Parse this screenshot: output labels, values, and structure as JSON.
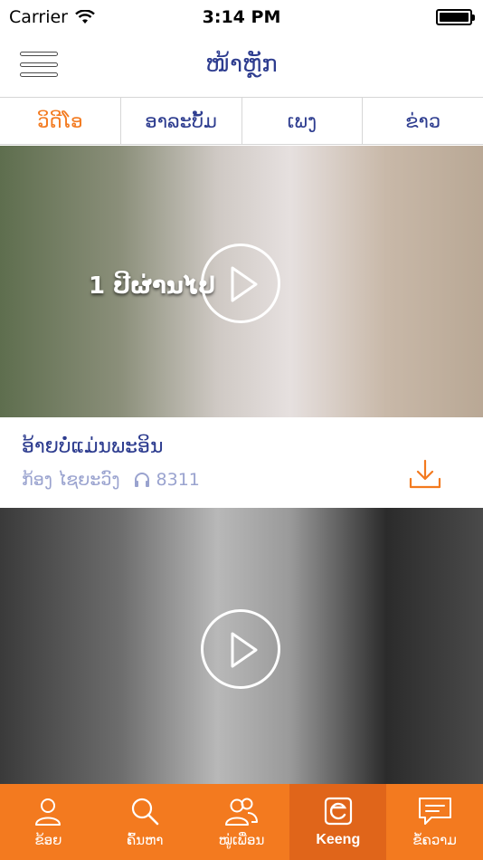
{
  "status_bar": {
    "carrier": "Carrier",
    "time": "3:14 PM"
  },
  "nav": {
    "title": "ໜ້າຫຼັກ",
    "menu_icon": "hamburger-menu-icon"
  },
  "tabs": [
    {
      "label": "ວິດີໂອ",
      "active": true
    },
    {
      "label": "ອາລະບັ້ມ",
      "active": false
    },
    {
      "label": "ເພງ",
      "active": false
    },
    {
      "label": "ຂ່າວ",
      "active": false
    }
  ],
  "videos": [
    {
      "overlay_text": "1 ປີຜ່ານໄປ",
      "title": "ອ້າຍບໍ່ແມ່ນພະອິນ",
      "artist": "ກ້ອງ ໄຊຍະວົງ",
      "play_count": "8311"
    },
    {
      "overlay_text": "",
      "title": "",
      "artist": "",
      "play_count": ""
    }
  ],
  "tab_bar": [
    {
      "label": "ຂ້ອຍ",
      "icon": "person-icon",
      "active": false
    },
    {
      "label": "ຄົ້ນຫາ",
      "icon": "search-icon",
      "active": false
    },
    {
      "label": "ໝູ່ເພື່ອນ",
      "icon": "friends-icon",
      "active": false
    },
    {
      "label": "Keeng",
      "icon": "keeng-logo-icon",
      "active": true
    },
    {
      "label": "ຂໍ້ຄວາມ",
      "icon": "message-icon",
      "active": false
    }
  ],
  "colors": {
    "accent": "#f37a1f",
    "accent_dark": "#e0651a",
    "text_blue": "#2d3c8f",
    "meta_blue": "#9aa3cf"
  }
}
